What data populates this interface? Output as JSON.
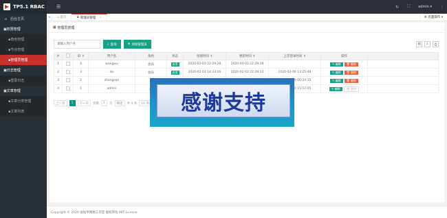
{
  "app": {
    "logo_text": "TP5.1 RBAC"
  },
  "header": {
    "menu_icon": "hamburger-icon",
    "user": "admin",
    "user_caret": "▾"
  },
  "sidebar": {
    "home": "后台主页",
    "groups": [
      {
        "label": "权限管理",
        "items": [
          "角色管理",
          "节点管理",
          "管理员管理"
        ]
      },
      {
        "label": "日志管理",
        "items": [
          "登录日志"
        ]
      },
      {
        "label": "文章管理",
        "items": [
          "文章分类管理",
          "文章列表"
        ]
      }
    ],
    "active_item": "管理员管理"
  },
  "tabs": {
    "prev": "◂",
    "home": "首页",
    "active": "管理员管理",
    "close": "×",
    "ops": "页面操作 ▾"
  },
  "panel": {
    "title": "管理员管理"
  },
  "search": {
    "placeholder": "请输入用户名",
    "query_btn": "查询",
    "add_btn": "添加管理员"
  },
  "table": {
    "headers": [
      "#",
      "",
      "ID",
      "用户名",
      "角色",
      "状态",
      "创建时间",
      "更新时间",
      "上次登录时间",
      "操作"
    ],
    "rows": [
      {
        "idx": "1",
        "id": "4",
        "username": "wangwu",
        "role": "会员",
        "status": "启用",
        "created": "2020-02-03 22:29:28",
        "updated": "2020-02-03 22:29:28",
        "last_login": "",
        "ops": [
          "编辑",
          "删除"
        ]
      },
      {
        "idx": "2",
        "id": "3",
        "username": "lisi",
        "role": "会员",
        "status": "启用",
        "created": "2020-02-02 14:33:26",
        "updated": "2020-02-03 22:29:12",
        "last_login": "2020-02-06 13:25:48",
        "ops": [
          "编辑",
          "删除"
        ]
      },
      {
        "idx": "3",
        "id": "2",
        "username": "zhangsan",
        "role": "",
        "status": "",
        "created": "",
        "updated": "",
        "last_login": "2020-02-09 00:34:15",
        "ops": [
          "编辑",
          "删除"
        ]
      },
      {
        "idx": "4",
        "id": "1",
        "username": "admin",
        "role": "超",
        "status": "",
        "created": "",
        "updated": "",
        "last_login": "2020-02-10 15:57:05",
        "ops": [
          "编辑",
          "删除"
        ]
      }
    ]
  },
  "pager": {
    "prev": "上一页",
    "current": "1",
    "next": "下一页",
    "goto_prefix": "到第",
    "page_value": "1",
    "page_unit": "页",
    "confirm": "确定",
    "total": "共 4 条",
    "per_page": "10 条/页"
  },
  "footer": {
    "text": "Copyright © 2020 张桓平网络工作室 版权所有 MIT License"
  },
  "overlay": {
    "text": "感谢支持"
  },
  "colors": {
    "accent": "#16a085",
    "danger": "#e8603c",
    "active": "#c9302c",
    "sidebar": "#293035"
  }
}
